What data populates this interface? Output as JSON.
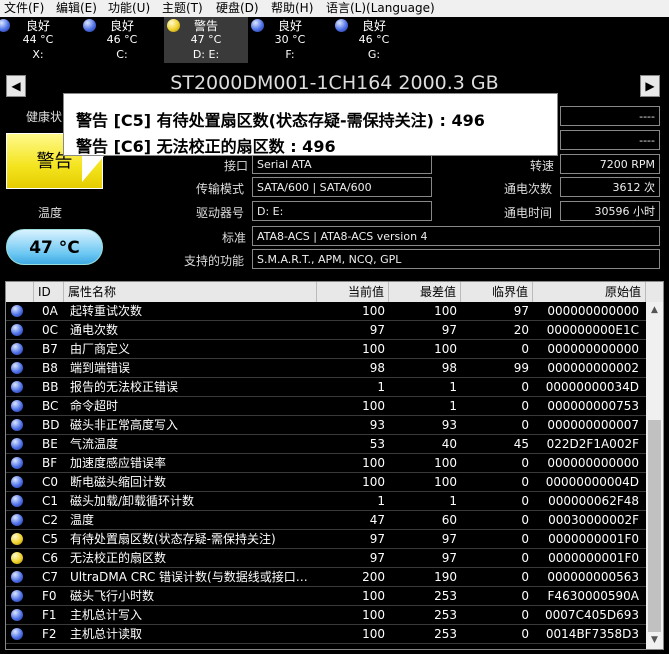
{
  "menu": [
    "文件(F)",
    "编辑(E)",
    "功能(U)",
    "主题(T)",
    "硬盘(D)",
    "帮助(H)",
    "语言(L)(Language)"
  ],
  "drives": [
    {
      "status": "良好",
      "temp": "44 °C",
      "letter": "X:",
      "color": "blue"
    },
    {
      "status": "良好",
      "temp": "46 °C",
      "letter": "C:",
      "color": "blue"
    },
    {
      "status": "警告",
      "temp": "47 °C",
      "letter": "D: E:",
      "color": "yellow"
    },
    {
      "status": "良好",
      "temp": "30 °C",
      "letter": "F:",
      "color": "blue"
    },
    {
      "status": "良好",
      "temp": "46 °C",
      "letter": "G:",
      "color": "blue"
    }
  ],
  "nav": {
    "prev": "◀",
    "next": "▶"
  },
  "title": "ST2000DM001-1CH164 2000.3 GB",
  "health": {
    "label": "健康状",
    "status": "警告"
  },
  "temperature": {
    "label": "温度",
    "value": "47 °C"
  },
  "tooltip": {
    "line1": "警告 [C5] 有待处置扇区数(状态存疑-需保持关注) : 496",
    "line2": "警告 [C6] 无法校正的扇区数 : 496"
  },
  "info": {
    "right_top1": "----",
    "right_top2": "----",
    "interface_label": "接口",
    "interface": "Serial ATA",
    "rpm_label": "转速",
    "rpm": "7200 RPM",
    "transfer_label": "传输模式",
    "transfer": "SATA/600 | SATA/600",
    "power_count_label": "通电次数",
    "power_count": "3612 次",
    "driveletter_label": "驱动器号",
    "driveletter": "D: E:",
    "power_hours_label": "通电时间",
    "power_hours": "30596 小时",
    "standard_label": "标准",
    "standard": "ATA8-ACS | ATA8-ACS version 4",
    "features_label": "支持的功能",
    "features": "S.M.A.R.T., APM, NCQ, GPL"
  },
  "table": {
    "headers": [
      "ID",
      "属性名称",
      "当前值",
      "最差值",
      "临界值",
      "原始值"
    ],
    "rows": [
      {
        "color": "blue",
        "id": "0A",
        "name": "起转重试次数",
        "cur": "100",
        "worst": "100",
        "thr": "97",
        "raw": "000000000000"
      },
      {
        "color": "blue",
        "id": "0C",
        "name": "通电次数",
        "cur": "97",
        "worst": "97",
        "thr": "20",
        "raw": "000000000E1C"
      },
      {
        "color": "blue",
        "id": "B7",
        "name": "由厂商定义",
        "cur": "100",
        "worst": "100",
        "thr": "0",
        "raw": "000000000000"
      },
      {
        "color": "blue",
        "id": "B8",
        "name": "端到端错误",
        "cur": "98",
        "worst": "98",
        "thr": "99",
        "raw": "000000000002"
      },
      {
        "color": "blue",
        "id": "BB",
        "name": "报告的无法校正错误",
        "cur": "1",
        "worst": "1",
        "thr": "0",
        "raw": "00000000034D"
      },
      {
        "color": "blue",
        "id": "BC",
        "name": "命令超时",
        "cur": "100",
        "worst": "1",
        "thr": "0",
        "raw": "000000000753"
      },
      {
        "color": "blue",
        "id": "BD",
        "name": "磁头非正常高度写入",
        "cur": "93",
        "worst": "93",
        "thr": "0",
        "raw": "000000000007"
      },
      {
        "color": "blue",
        "id": "BE",
        "name": "气流温度",
        "cur": "53",
        "worst": "40",
        "thr": "45",
        "raw": "022D2F1A002F"
      },
      {
        "color": "blue",
        "id": "BF",
        "name": "加速度感应错误率",
        "cur": "100",
        "worst": "100",
        "thr": "0",
        "raw": "000000000000"
      },
      {
        "color": "blue",
        "id": "C0",
        "name": "断电磁头缩回计数",
        "cur": "100",
        "worst": "100",
        "thr": "0",
        "raw": "00000000004D"
      },
      {
        "color": "blue",
        "id": "C1",
        "name": "磁头加载/卸载循环计数",
        "cur": "1",
        "worst": "1",
        "thr": "0",
        "raw": "000000062F48"
      },
      {
        "color": "blue",
        "id": "C2",
        "name": "温度",
        "cur": "47",
        "worst": "60",
        "thr": "0",
        "raw": "00030000002F"
      },
      {
        "color": "yellow",
        "id": "C5",
        "name": "有待处置扇区数(状态存疑-需保持关注)",
        "cur": "97",
        "worst": "97",
        "thr": "0",
        "raw": "0000000001F0"
      },
      {
        "color": "yellow",
        "id": "C6",
        "name": "无法校正的扇区数",
        "cur": "97",
        "worst": "97",
        "thr": "0",
        "raw": "0000000001F0"
      },
      {
        "color": "blue",
        "id": "C7",
        "name": "UltraDMA CRC 错误计数(与数据线或接口…",
        "cur": "200",
        "worst": "190",
        "thr": "0",
        "raw": "000000000563"
      },
      {
        "color": "blue",
        "id": "F0",
        "name": "磁头飞行小时数",
        "cur": "100",
        "worst": "253",
        "thr": "0",
        "raw": "F4630000590A"
      },
      {
        "color": "blue",
        "id": "F1",
        "name": "主机总计写入",
        "cur": "100",
        "worst": "253",
        "thr": "0",
        "raw": "0007C405D693"
      },
      {
        "color": "blue",
        "id": "F2",
        "name": "主机总计读取",
        "cur": "100",
        "worst": "253",
        "thr": "0",
        "raw": "0014BF7358D3"
      }
    ]
  },
  "colors": {
    "blue": "#4f72e8",
    "yellow": "#f0d22c",
    "accent": "#3ea9e3"
  }
}
